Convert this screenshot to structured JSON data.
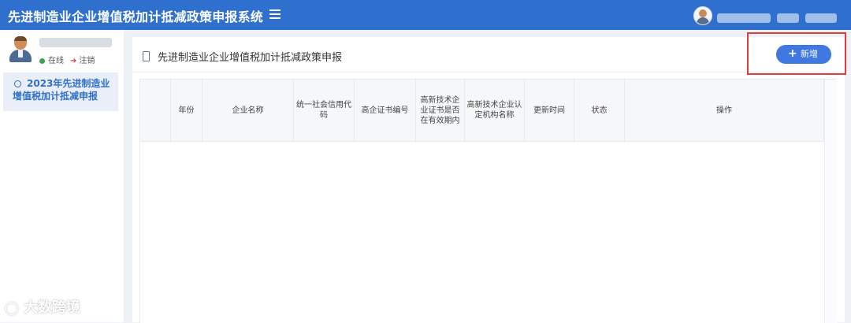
{
  "header": {
    "title": "先进制造业企业增值税加计抵减政策申报系统",
    "menu_icon": "hamburger-menu-icon",
    "user_avatar_icon": "user-avatar-icon"
  },
  "sidebar": {
    "status_online": "在线",
    "logout": "注销",
    "menu_items": [
      {
        "label": "2023年先进制造业增值税加计抵减申报",
        "icon": "circle-icon",
        "active": true
      }
    ]
  },
  "main": {
    "page_title": "先进制造业企业增值税加计抵减政策申报",
    "add_button_label": "新增",
    "add_button_icon": "plus-icon",
    "table": {
      "columns": [
        "",
        "年份",
        "企业名称",
        "统一社会信用代码",
        "高企证书编号",
        "高新技术企业证书是否在有效期内",
        "高新技术企业认定机构名称",
        "更新时间",
        "状态",
        "操作"
      ],
      "rows": []
    }
  },
  "watermark": {
    "text": "大数跨境"
  },
  "colors": {
    "header_bg": "#2f6fce",
    "primary_button": "#3f78e0",
    "highlight_border": "#e23b3b",
    "online_dot": "#3fa34d"
  }
}
